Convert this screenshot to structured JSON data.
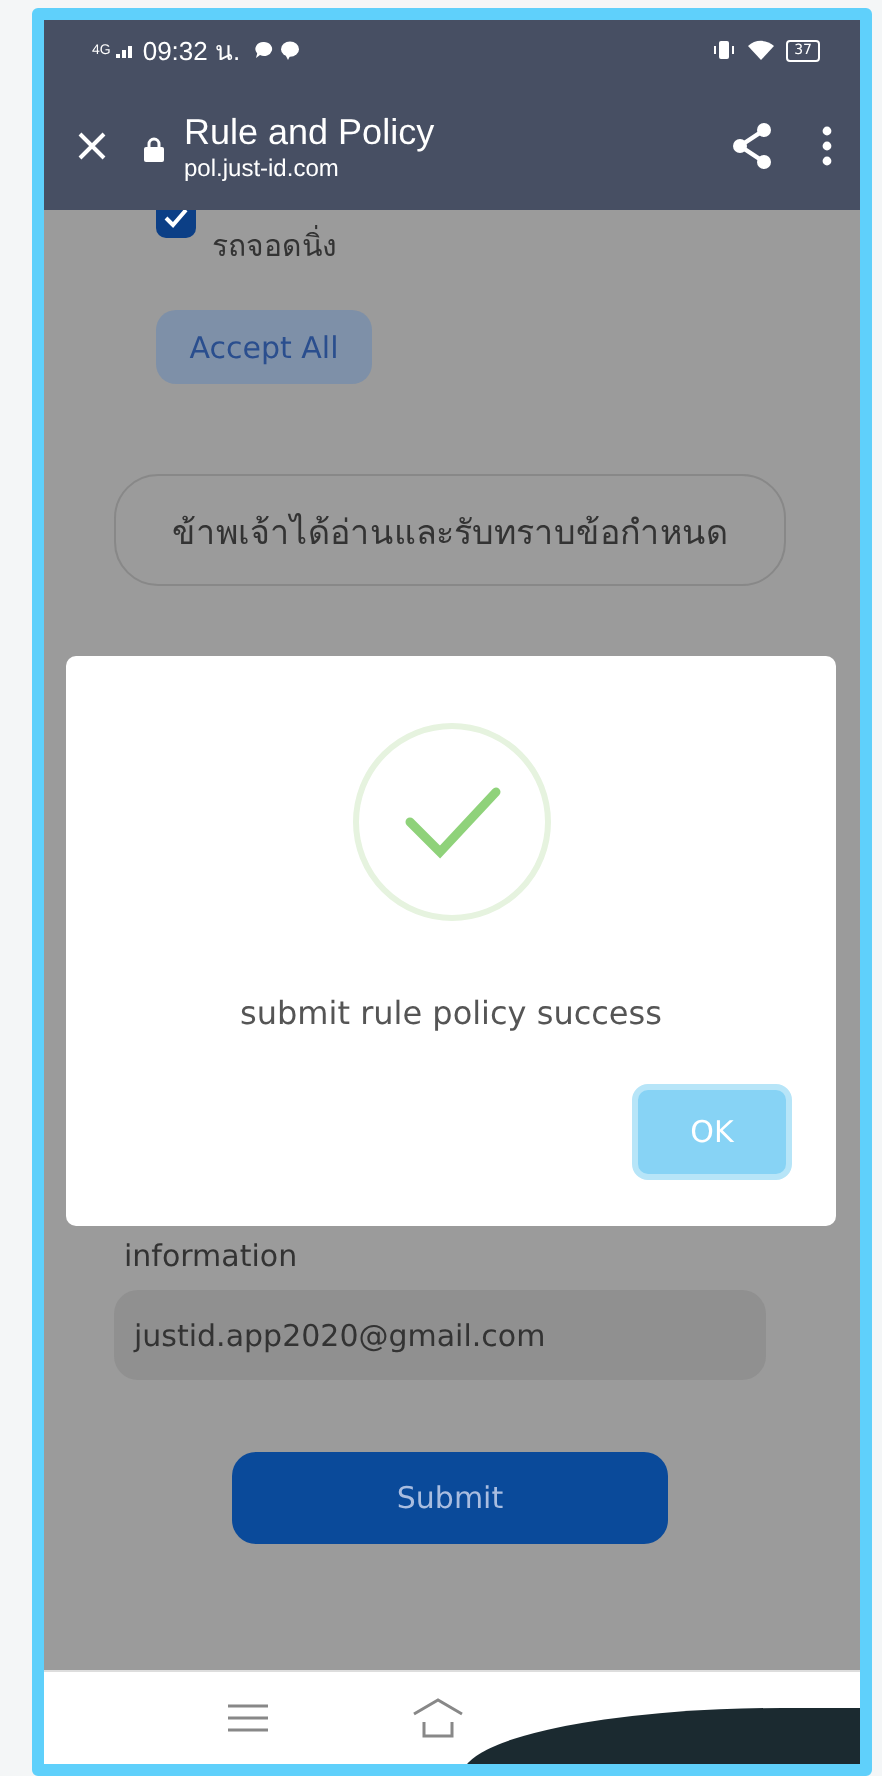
{
  "status_bar": {
    "network": "4G",
    "time": "09:32 น.",
    "battery": "37"
  },
  "toolbar": {
    "title": "Rule and Policy",
    "url": "pol.just-id.com"
  },
  "page": {
    "consent": {
      "label": "รถจอดนิ่ง",
      "checked": true
    },
    "accept_all": "Accept All",
    "acknowledge": "ข้าพเจ้าได้อ่านและรับทราบข้อกำหนด",
    "info_label": "information",
    "email": "justid.app2020@gmail.com",
    "submit": "Submit"
  },
  "dialog": {
    "message": "submit rule policy success",
    "ok": "OK"
  }
}
